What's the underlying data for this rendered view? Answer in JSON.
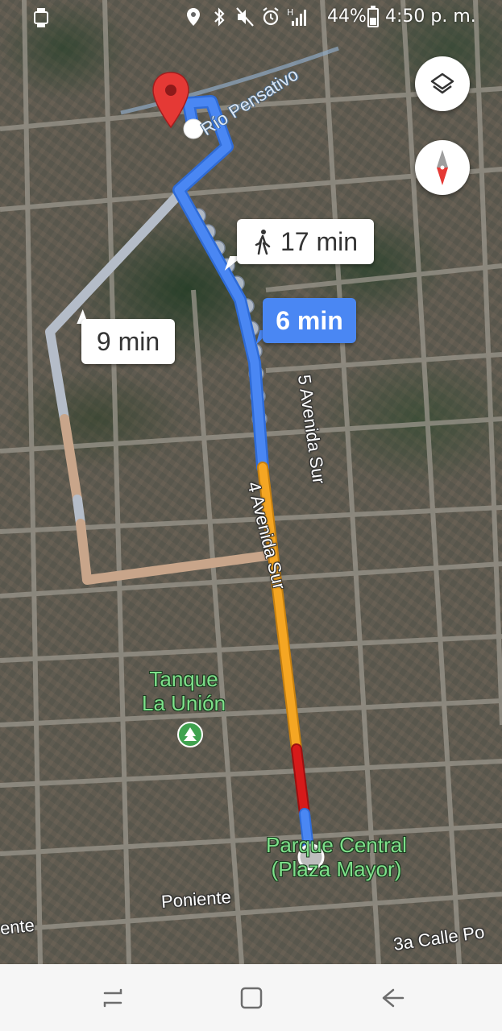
{
  "status_bar": {
    "battery_percent": "44%",
    "time": "4:50 p. m.",
    "icons": [
      "watch-icon",
      "location-icon",
      "bluetooth-icon",
      "mute-icon",
      "alarm-icon",
      "hplus-signal-icon",
      "battery-icon"
    ],
    "network_letter": "H"
  },
  "map": {
    "route_times": {
      "walk": "17 min",
      "selected": "6 min",
      "alternative": "9 min"
    },
    "labels": {
      "river": "Río Pensativo",
      "street_5av": "5 Avenida Sur",
      "street_4av": "4 Avenida Sur",
      "poniente": "Poniente",
      "ente": "ente",
      "calle_3a": "3a Calle Po",
      "tanque": "Tanque\nLa Unión",
      "parque": "Parque Central\n(Plaza Mayor)"
    },
    "colors": {
      "route_blue": "#4a87f3",
      "traffic_orange": "#f5a623",
      "traffic_red": "#d61a1a",
      "alt_route_gray": "#b4bcc8",
      "alt_route_tan": "#c8a58a",
      "destination_pin": "#e53935"
    }
  },
  "controls": {
    "layers": "layers-icon",
    "compass": "compass-icon"
  },
  "nav_bar": {
    "recents": "recents-icon",
    "home": "home-icon",
    "back": "back-icon"
  }
}
